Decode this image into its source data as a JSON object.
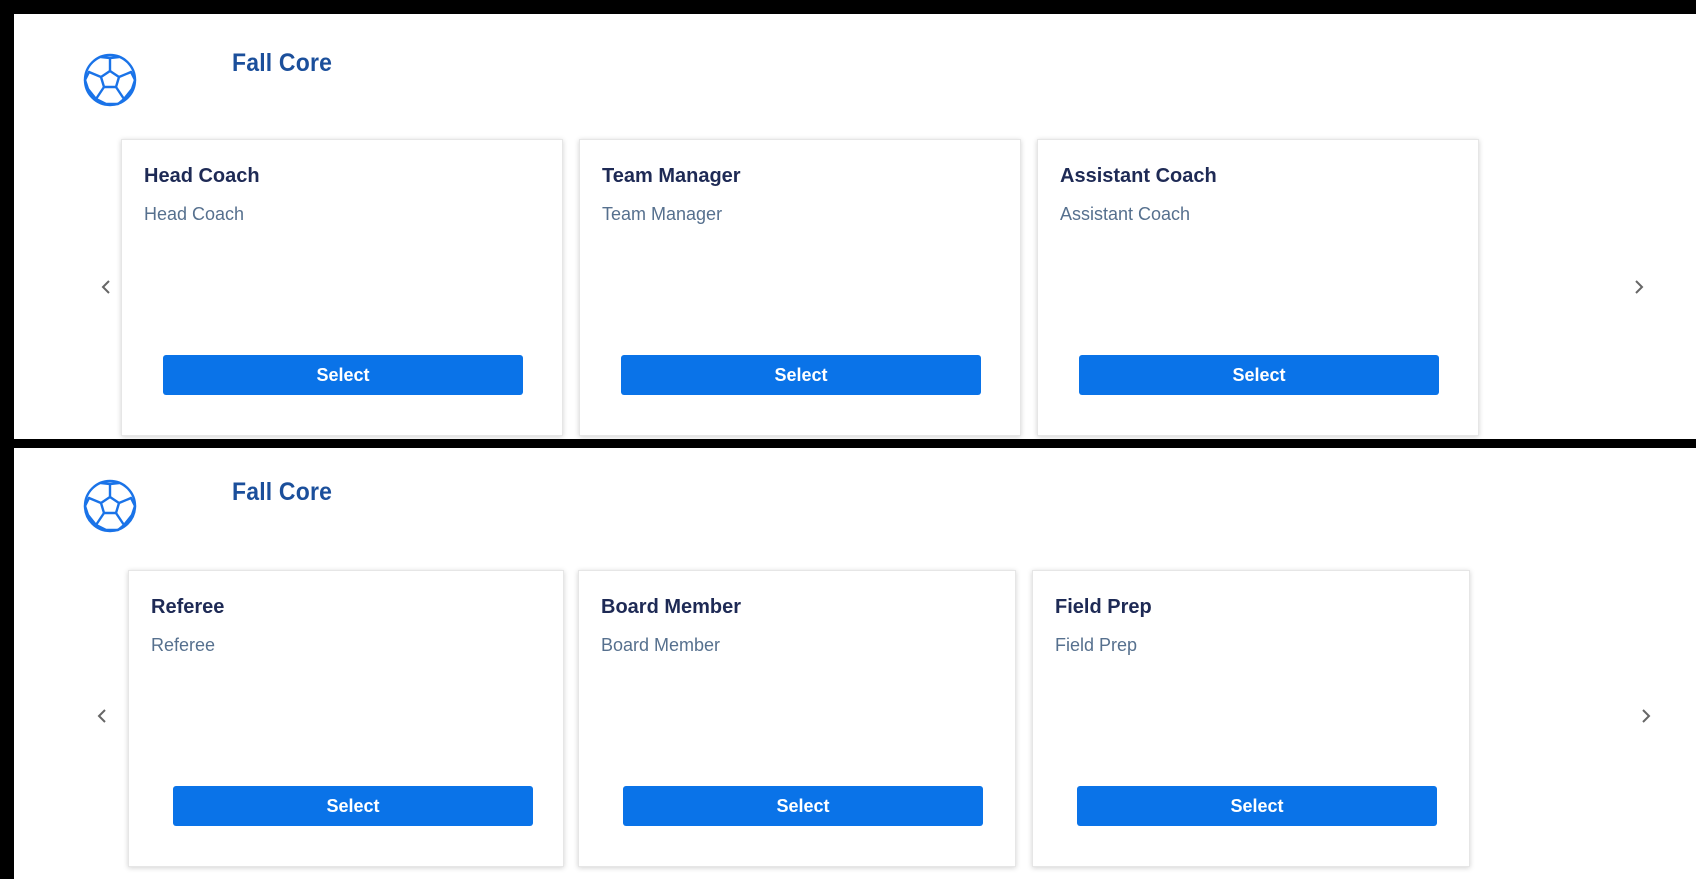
{
  "colors": {
    "title": "#1b4f9b",
    "card_title": "#1e2a55",
    "card_subtitle": "#56708e",
    "button_bg": "#0a73e8",
    "button_text": "#ffffff",
    "arrow": "#666666"
  },
  "sections": [
    {
      "icon": "soccer-ball-icon",
      "title": "Fall Core",
      "prev_icon": "chevron-left-icon",
      "next_icon": "chevron-right-icon",
      "cards": [
        {
          "title": "Head Coach",
          "subtitle": "Head Coach",
          "button": "Select"
        },
        {
          "title": "Team Manager",
          "subtitle": "Team Manager",
          "button": "Select"
        },
        {
          "title": "Assistant Coach",
          "subtitle": "Assistant Coach",
          "button": "Select"
        }
      ]
    },
    {
      "icon": "soccer-ball-icon",
      "title": "Fall Core",
      "prev_icon": "chevron-left-icon",
      "next_icon": "chevron-right-icon",
      "cards": [
        {
          "title": "Referee",
          "subtitle": "Referee",
          "button": "Select"
        },
        {
          "title": "Board Member",
          "subtitle": "Board Member",
          "button": "Select"
        },
        {
          "title": "Field Prep",
          "subtitle": "Field Prep",
          "button": "Select"
        }
      ]
    }
  ]
}
